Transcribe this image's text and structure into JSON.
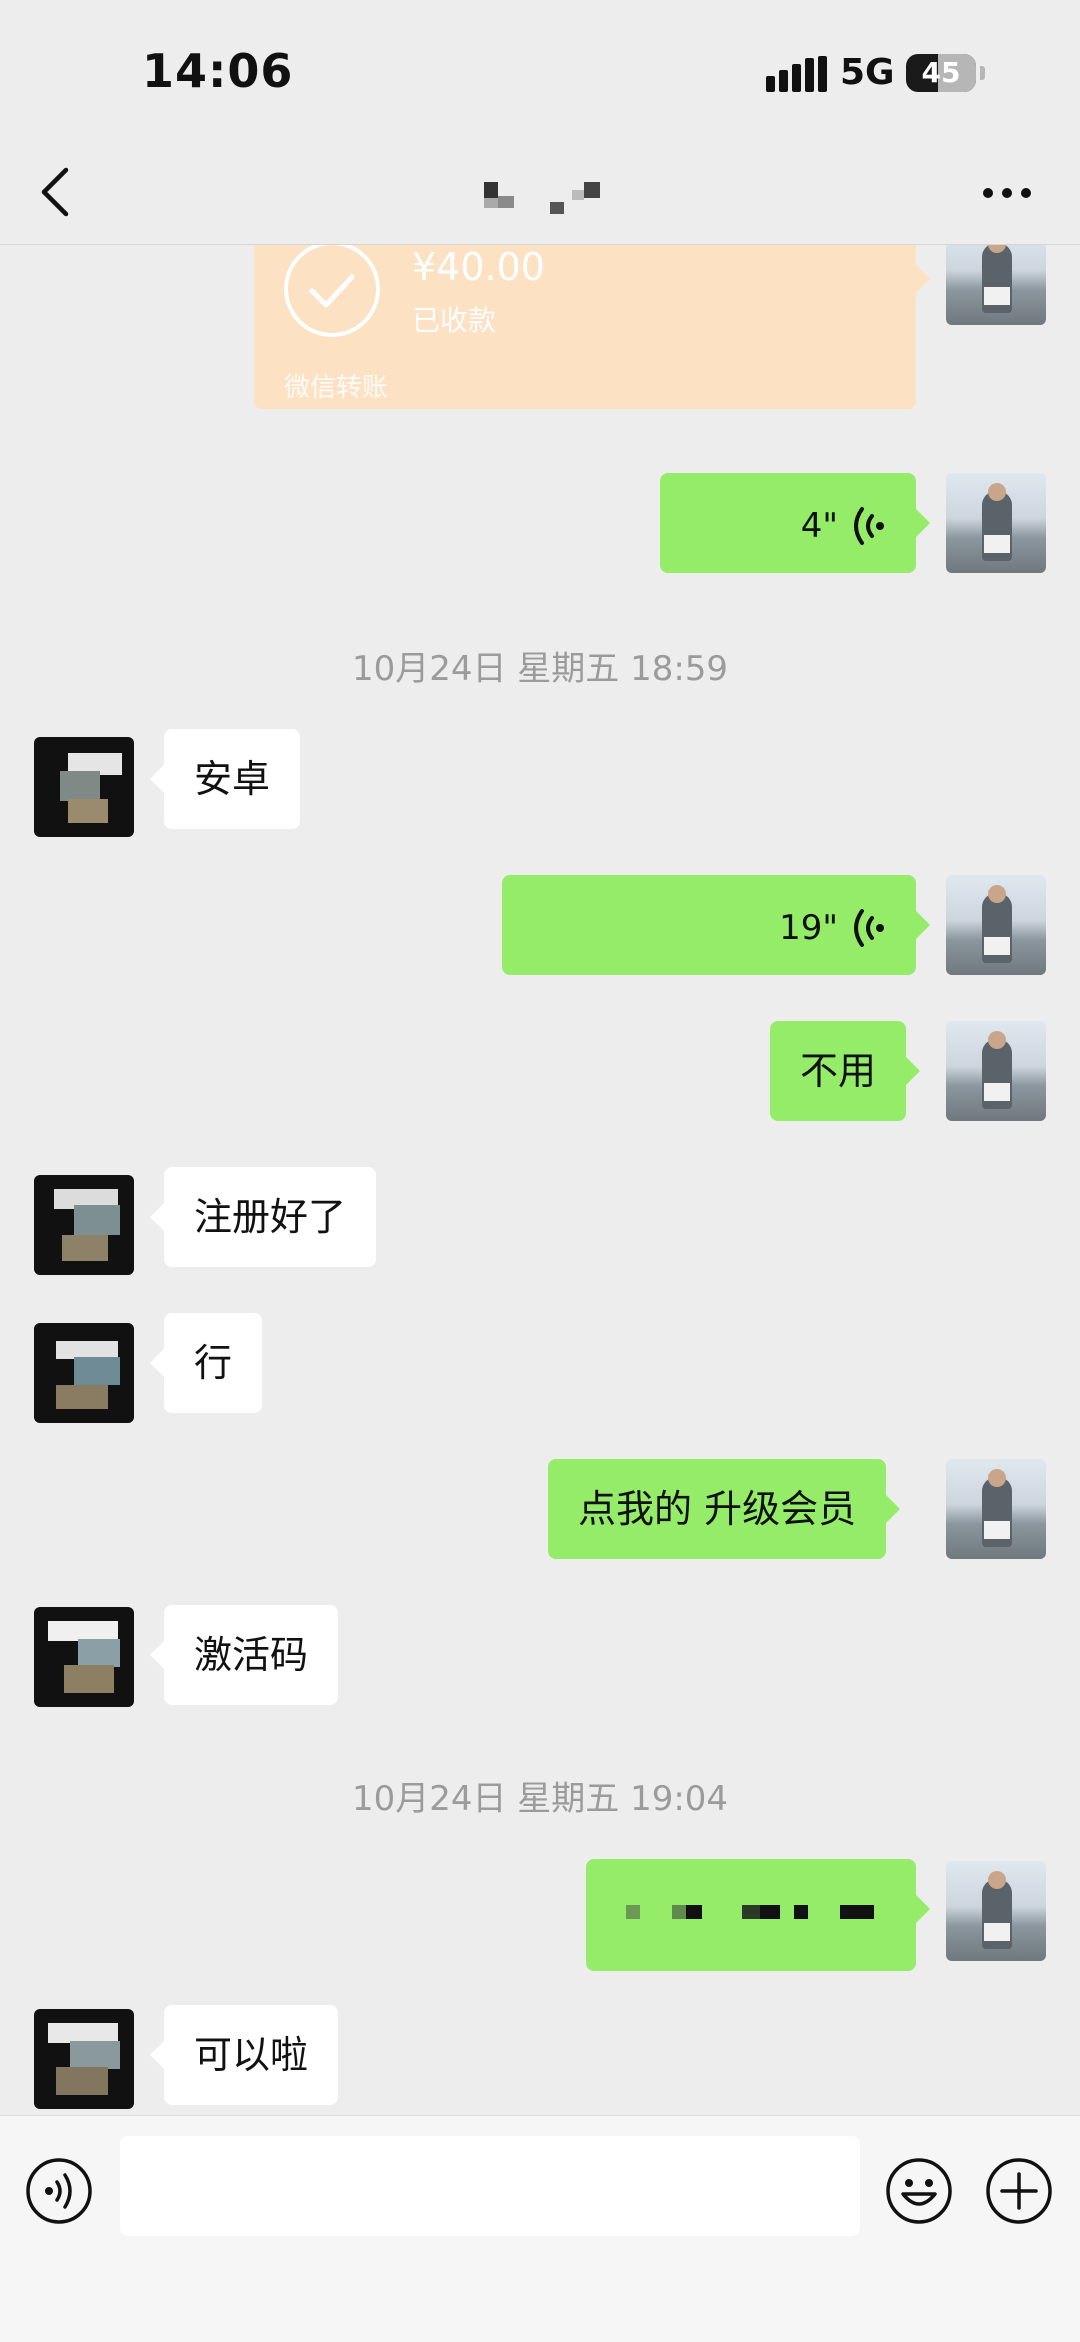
{
  "status_bar": {
    "time": "14:06",
    "network": "5G",
    "battery": "45"
  },
  "nav": {
    "back_icon": "chevron-left-icon",
    "title": "",
    "more_icon": "more-icon"
  },
  "messages": {
    "transfer": {
      "amount": "¥40.00",
      "status": "已收款",
      "footer": "微信转账"
    },
    "voice1": {
      "duration": "4\""
    },
    "time1": "10月24日 星期五 18:59",
    "m_anzhuo": "安卓",
    "voice2": {
      "duration": "19\""
    },
    "m_buyong": "不用",
    "m_zhuce": "注册好了",
    "m_xing": "行",
    "m_shengji": "点我的 升级会员",
    "m_jihuoma": "激活码",
    "time2": "10月24日 星期五 19:04",
    "m_keyila": "可以啦"
  },
  "input_bar": {
    "voice_icon": "voice-input-icon",
    "emoji_icon": "emoji-icon",
    "plus_icon": "plus-icon",
    "value": ""
  },
  "colors": {
    "background": "#ededed",
    "sent_bubble": "#95ec69",
    "received_bubble": "#ffffff",
    "transfer_card": "#fde1c3"
  }
}
